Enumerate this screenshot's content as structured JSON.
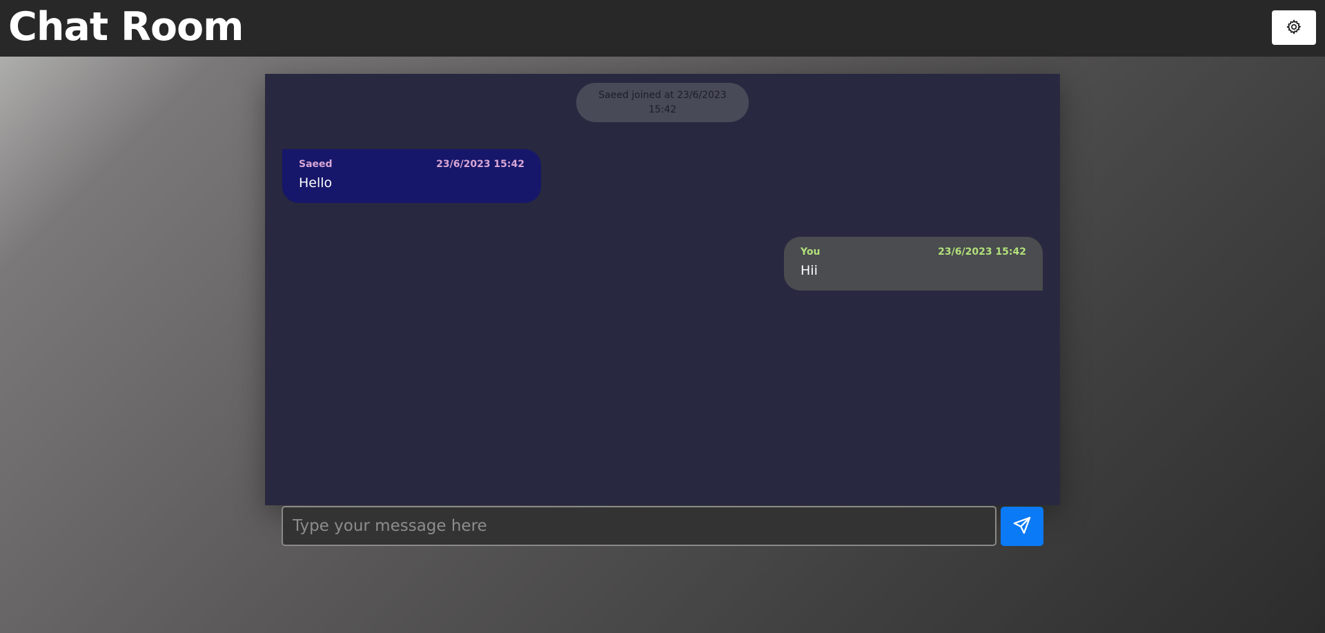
{
  "app": {
    "title": "Chat Room"
  },
  "icons": {
    "settings": "gear-icon",
    "send": "paper-plane-icon"
  },
  "chat": {
    "system_messages": [
      {
        "text": "Saeed joined at 23/6/2023 15:42"
      }
    ],
    "messages": [
      {
        "sender": "Saeed",
        "time": "23/6/2023 15:42",
        "text": "Hello",
        "direction": "incoming"
      },
      {
        "sender": "You",
        "time": "23/6/2023 15:42",
        "text": "Hii",
        "direction": "outgoing"
      }
    ]
  },
  "composer": {
    "value": "",
    "placeholder": "Type your message here"
  },
  "colors": {
    "topbar": "#282828",
    "chat_panel": "#282840",
    "incoming_bubble": "#16166a",
    "outgoing_bubble": "#4a4c4f",
    "incoming_meta": "#d9a8d6",
    "outgoing_meta": "#b3e07c",
    "send_button": "#0a7af6"
  }
}
